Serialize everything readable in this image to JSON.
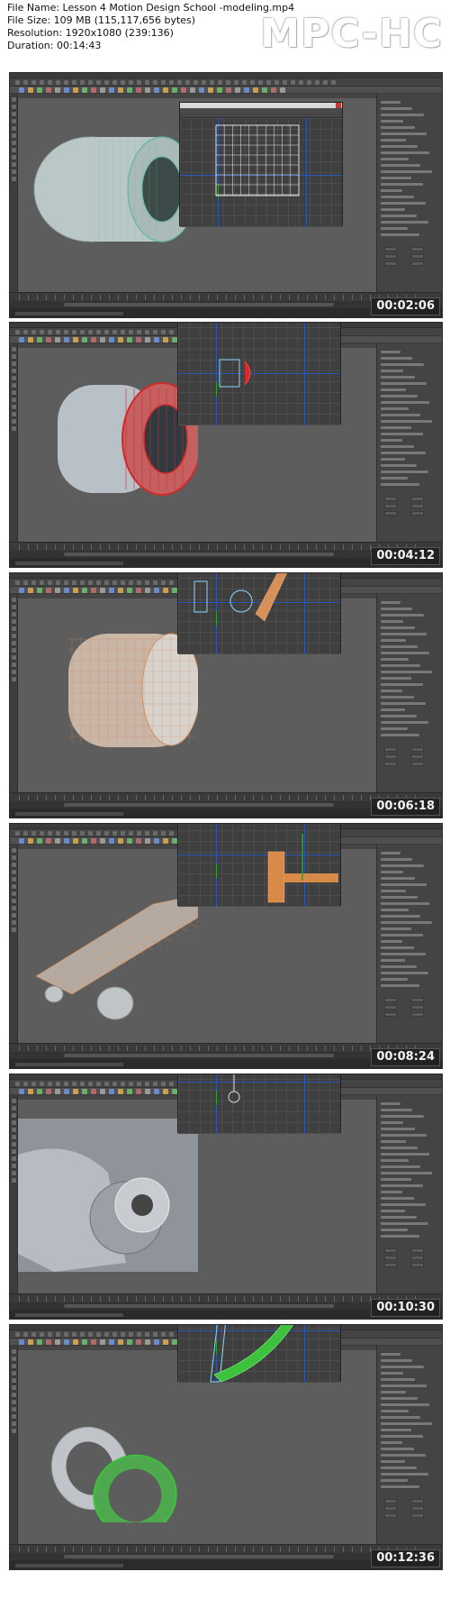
{
  "header": {
    "file_name": "File Name: Lesson 4 Motion Design School -modeling.mp4",
    "file_size": "File Size: 109 MB (115,117,656 bytes)",
    "resolution": "Resolution: 1920x1080 (239:136)",
    "duration": "Duration: 00:14:43",
    "logo": "MPC-HC"
  },
  "frames": [
    {
      "timestamp": "00:02:06",
      "object": "tube-wireframe-icon",
      "colors": {
        "mesh": "#b9c7c6",
        "wire": "#5fb8a0"
      }
    },
    {
      "timestamp": "00:04:12",
      "object": "tube-red-edges-icon",
      "colors": {
        "mesh": "#b8c1c7",
        "wire": "#d22a2a"
      }
    },
    {
      "timestamp": "00:06:18",
      "object": "cylinder-uv-numbers-icon",
      "colors": {
        "mesh": "#c9b6a6",
        "wire": "#d09060"
      }
    },
    {
      "timestamp": "00:08:24",
      "object": "longboard-deck-icon",
      "colors": {
        "mesh": "#b5aaa2",
        "wire": "#e08a40"
      }
    },
    {
      "timestamp": "00:10:30",
      "object": "truck-hardware-closeup-icon",
      "colors": {
        "mesh": "#b7bcc4",
        "wire": "#e8e8e8"
      }
    },
    {
      "timestamp": "00:12:36",
      "object": "wheel-green-selection-icon",
      "colors": {
        "mesh": "#c0c4c8",
        "wire": "#3ec23e"
      }
    }
  ],
  "colors": {
    "background": "#ffffff",
    "maya_ui": "#4a4a4a",
    "viewport": "#5d5d5d",
    "uv_axis": "#2e55b8",
    "timestamp_bg": "#222222"
  }
}
